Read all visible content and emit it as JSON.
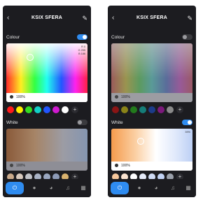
{
  "screens": [
    {
      "title": "KSIX SFERA",
      "colour_label": "Colour",
      "colour_on": true,
      "rgb_readout": [
        "R 0",
        "G 255",
        "B 186"
      ],
      "colour_brightness": "100%",
      "white_label": "White",
      "white_on": false,
      "white_brightness": "100%",
      "colour_swatches": [
        "#ff1a1a",
        "#ffee00",
        "#33dd22",
        "#11d0c8",
        "#2255ff",
        "#d01ad0",
        "#ffffff"
      ],
      "white_swatches": [
        "#c9a98a",
        "#d7c9bd",
        "#c0c2c8",
        "#a9b3c6",
        "#9aa7c0",
        "#8d9bb7",
        "#d9b26e"
      ]
    },
    {
      "title": "KSIX SFERA",
      "colour_label": "Colour",
      "colour_on": false,
      "colour_brightness": "100%",
      "white_label": "White",
      "white_on": true,
      "white_readout": "39%",
      "white_brightness": "100%",
      "colour_swatches": [
        "#8a1515",
        "#8a8318",
        "#227a1c",
        "#157d78",
        "#1c3c8a",
        "#7c197c",
        "#8a8a8a"
      ],
      "white_swatches": [
        "#f6c79b",
        "#fbe4d0",
        "#ffffff",
        "#e6ecfa",
        "#cfdbf5",
        "#c2d3f5",
        "#9aa0aa"
      ]
    }
  ],
  "icons": {
    "back": "‹",
    "edit": "✎",
    "plus": "+",
    "power": "⏻",
    "bulb": "💡",
    "palette": "◕",
    "music": "♫",
    "scenes": "▦"
  },
  "colors": {
    "accent": "#2f8cf0",
    "background": "#1c1c20"
  }
}
